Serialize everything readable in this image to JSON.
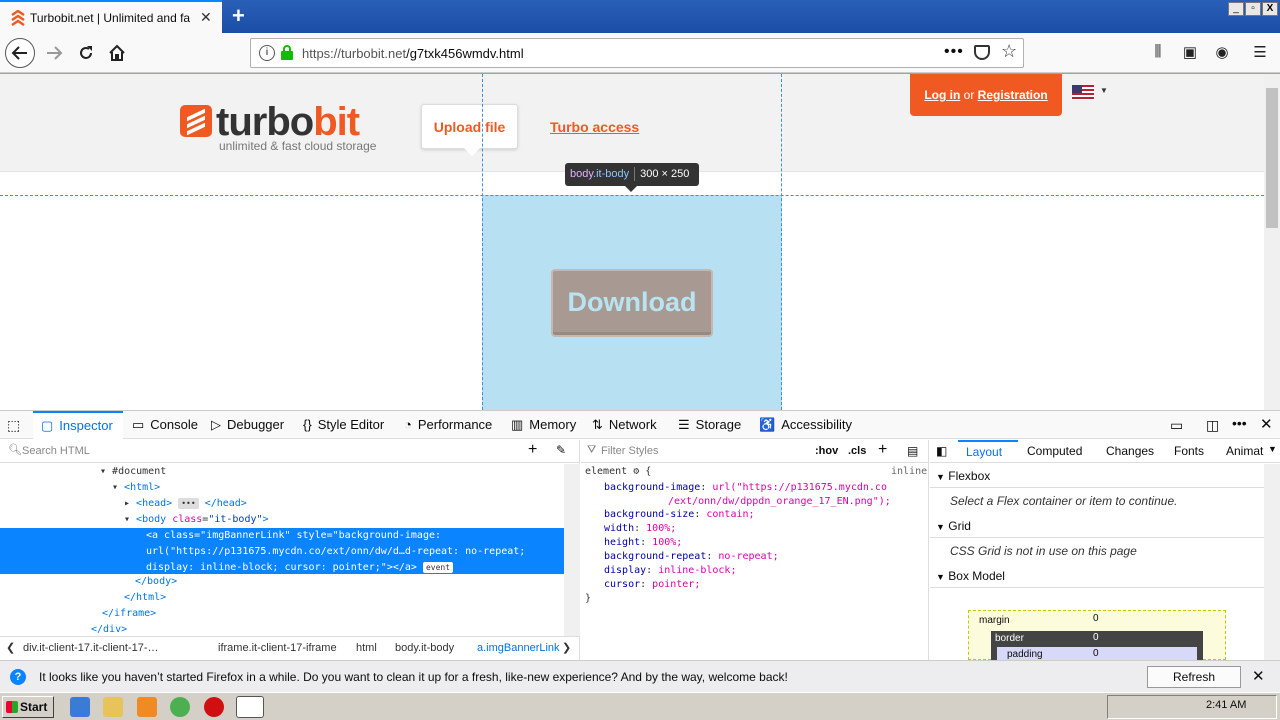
{
  "browser": {
    "tab_title": "Turbobit.net | Unlimited and fast file",
    "url_host": "https://turbobit.net",
    "url_path": "/g7txk456wmdv.html",
    "new_tab_symbol": "+",
    "win_controls": [
      "_",
      "▫",
      "X"
    ]
  },
  "webpage": {
    "logo_word1": "turbo",
    "logo_word2": "bit",
    "logo_tagline": "unlimited & fast cloud storage",
    "upload_label": "Upload file",
    "turbo_access_label": "Turbo access",
    "login_label": "Log in",
    "or_label": "or",
    "register_label": "Registration",
    "download_label": "Download",
    "highlight_color": "#b7e0f2",
    "brand_color": "#f05a22"
  },
  "inspector_tooltip": {
    "tag": "body",
    "cls": ".it-body",
    "size": "300 × 250"
  },
  "devtools": {
    "tabs": [
      {
        "label": "Inspector",
        "icon": "inspector-icon"
      },
      {
        "label": "Console",
        "icon": "console-icon"
      },
      {
        "label": "Debugger",
        "icon": "debugger-icon"
      },
      {
        "label": "Style Editor",
        "icon": "style-editor-icon"
      },
      {
        "label": "Performance",
        "icon": "performance-icon"
      },
      {
        "label": "Memory",
        "icon": "memory-icon"
      },
      {
        "label": "Network",
        "icon": "network-icon"
      },
      {
        "label": "Storage",
        "icon": "storage-icon"
      },
      {
        "label": "Accessibility",
        "icon": "accessibility-icon"
      }
    ],
    "search_html_placeholder": "Search HTML",
    "markup": {
      "document": "#document",
      "html_open": "<html>",
      "head": "<head>",
      "head_close": "</head>",
      "body_open_tag": "<body",
      "body_attr": "class",
      "body_val": "\"it-body\"",
      "sel_line1": "<a class=\"imgBannerLink\" style=\"background-image:",
      "sel_line2": "url(\"https://p131675.mycdn.co/ext/onn/dw/d…d-repeat: no-repeat;",
      "sel_line3": "display: inline-block; cursor: pointer;\"></a>",
      "event_badge": "event",
      "body_close": "</body>",
      "html_close": "</html>",
      "iframe_close": "</iframe>",
      "div_close": "</div>"
    },
    "breadcrumbs": [
      "div.it-client-17.it-client-17-…",
      "iframe.it-client-17-iframe",
      "html",
      "body.it-body",
      "a.imgBannerLink"
    ],
    "filter_styles_placeholder": "Filter Styles",
    "hov_label": ":hov",
    "cls_label": ".cls",
    "rule_selector": "element",
    "rule_inline": "inline",
    "rule_props": [
      {
        "p": "background-image",
        "v": "url(\"https://p131675.mycdn.co"
      },
      {
        "p": "",
        "v": "/ext/onn/dw/dppdn_orange_17_EN.png\");"
      },
      {
        "p": "background-size",
        "v": "contain;"
      },
      {
        "p": "width",
        "v": "100%;"
      },
      {
        "p": "height",
        "v": "100%;"
      },
      {
        "p": "background-repeat",
        "v": "no-repeat;"
      },
      {
        "p": "display",
        "v": "inline-block;"
      },
      {
        "p": "cursor",
        "v": "pointer;"
      }
    ],
    "side_tabs": [
      "Layout",
      "Computed",
      "Changes",
      "Fonts",
      "Animat"
    ],
    "flexbox_label": "Flexbox",
    "flexbox_msg": "Select a Flex container or item to continue.",
    "grid_label": "Grid",
    "grid_msg": "CSS Grid is not in use on this page",
    "boxmodel_label": "Box Model",
    "bm_margin": "margin",
    "bm_border": "border",
    "bm_padding": "padding",
    "bm_zero": "0"
  },
  "notification": {
    "message": "It looks like you haven’t started Firefox in a while. Do you want to clean it up for a fresh, like-new experience? And by the way, welcome back!",
    "button": "Refresh Firefox…"
  },
  "taskbar": {
    "start_label": "Start",
    "clock": "2:41 AM"
  }
}
